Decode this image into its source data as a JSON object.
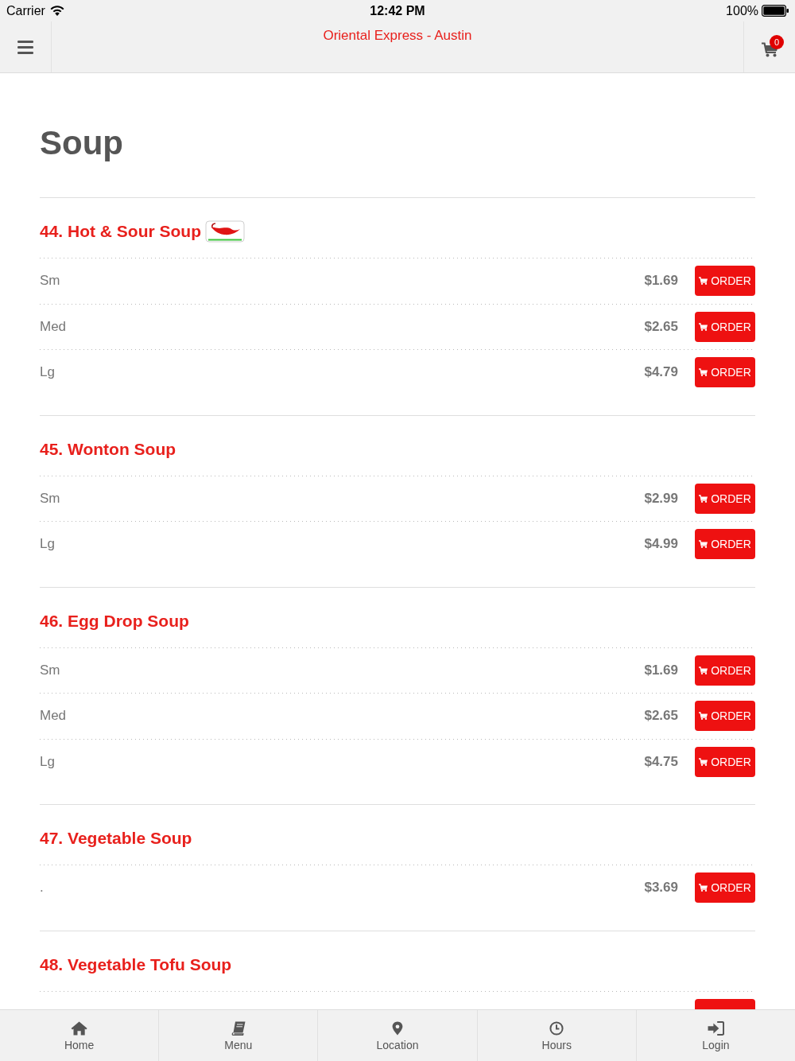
{
  "status_bar": {
    "carrier": "Carrier",
    "time": "12:42 PM",
    "battery": "100%"
  },
  "header": {
    "title": "Oriental Express - Austin",
    "cart_count": "0"
  },
  "page_title": "Soup",
  "items": [
    {
      "title": "44. Hot & Sour Soup",
      "spicy": true,
      "more_below": false,
      "sizes": [
        {
          "label": "Sm",
          "price": "$1.69",
          "button": "ORDER"
        },
        {
          "label": "Med",
          "price": "$2.65",
          "button": "ORDER"
        },
        {
          "label": "Lg",
          "price": "$4.79",
          "button": "ORDER"
        }
      ]
    },
    {
      "title": "45. Wonton Soup",
      "spicy": false,
      "more_below": false,
      "sizes": [
        {
          "label": "Sm",
          "price": "$2.99",
          "button": "ORDER"
        },
        {
          "label": "Lg",
          "price": "$4.99",
          "button": "ORDER"
        }
      ]
    },
    {
      "title": "46. Egg Drop Soup",
      "spicy": false,
      "more_below": false,
      "sizes": [
        {
          "label": "Sm",
          "price": "$1.69",
          "button": "ORDER"
        },
        {
          "label": "Med",
          "price": "$2.65",
          "button": "ORDER"
        },
        {
          "label": "Lg",
          "price": "$4.75",
          "button": "ORDER"
        }
      ]
    },
    {
      "title": "47. Vegetable Soup",
      "spicy": false,
      "more_below": false,
      "sizes": [
        {
          "label": ".",
          "price": "$3.69",
          "button": "ORDER"
        }
      ]
    },
    {
      "title": "48. Vegetable Tofu Soup",
      "spicy": false,
      "more_below": true
    }
  ],
  "tab_bar": [
    {
      "label": "Home",
      "selected": false
    },
    {
      "label": "Menu",
      "selected": false
    },
    {
      "label": "Location",
      "selected": false
    },
    {
      "label": "Hours",
      "selected": false
    },
    {
      "label": "Login",
      "selected": false
    }
  ]
}
